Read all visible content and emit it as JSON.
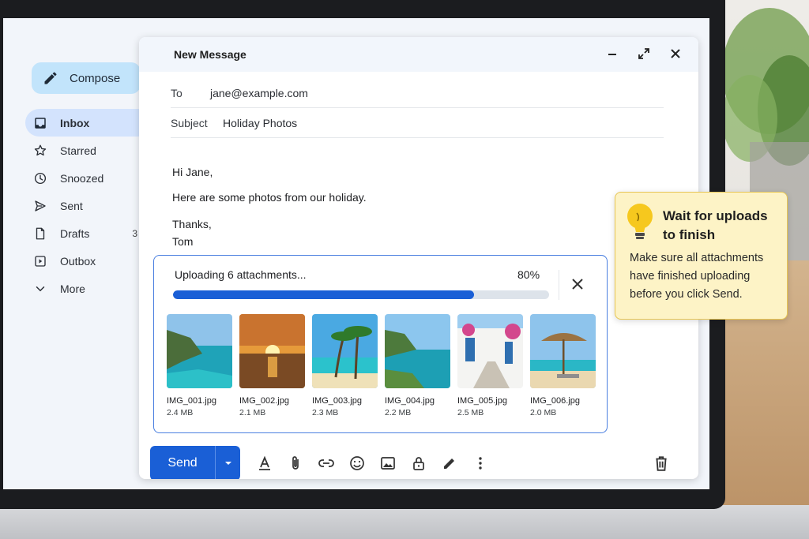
{
  "sidebar": {
    "compose_label": "Compose",
    "items": [
      {
        "label": "Inbox",
        "icon": "inbox-icon"
      },
      {
        "label": "Starred",
        "icon": "star-icon"
      },
      {
        "label": "Snoozed",
        "icon": "clock-icon"
      },
      {
        "label": "Sent",
        "icon": "send-icon"
      },
      {
        "label": "Drafts",
        "icon": "draft-icon",
        "count": "3"
      },
      {
        "label": "Outbox",
        "icon": "outbox-icon"
      },
      {
        "label": "More",
        "icon": "chevron-down-icon"
      }
    ]
  },
  "compose": {
    "title": "New Message",
    "to_label": "To",
    "to_value": "jane@example.com",
    "subject_label": "Subject",
    "subject_value": "Holiday Photos",
    "body": [
      "Hi Jane,",
      "",
      "Here are some photos from our holiday.",
      "",
      "Thanks,",
      "Tom"
    ]
  },
  "upload": {
    "status": "Uploading 6 attachments...",
    "percent_label": "80%",
    "progress": 0.8,
    "files": [
      {
        "name": "IMG_001.jpg",
        "size": "2.4 MB"
      },
      {
        "name": "IMG_002.jpg",
        "size": "2.1 MB"
      },
      {
        "name": "IMG_003.jpg",
        "size": "2.3 MB"
      },
      {
        "name": "IMG_004.jpg",
        "size": "2.2 MB"
      },
      {
        "name": "IMG_005.jpg",
        "size": "2.5 MB"
      },
      {
        "name": "IMG_006.jpg",
        "size": "2.0 MB"
      }
    ]
  },
  "toolbar": {
    "send_label": "Send",
    "tools": [
      "format-text-icon",
      "attach-icon",
      "link-icon",
      "emoji-icon",
      "image-icon",
      "lock-icon",
      "signature-icon",
      "more-options-icon"
    ]
  },
  "tooltip": {
    "title": "Wait for uploads to finish",
    "body": "Make sure all attachments have finished uploading before you click Send."
  },
  "colors": {
    "accent": "#1a5fd6",
    "compose_button": "#c2e4fb",
    "nav_active": "#d3e3fd",
    "tooltip_bg": "#fdf3c6"
  }
}
